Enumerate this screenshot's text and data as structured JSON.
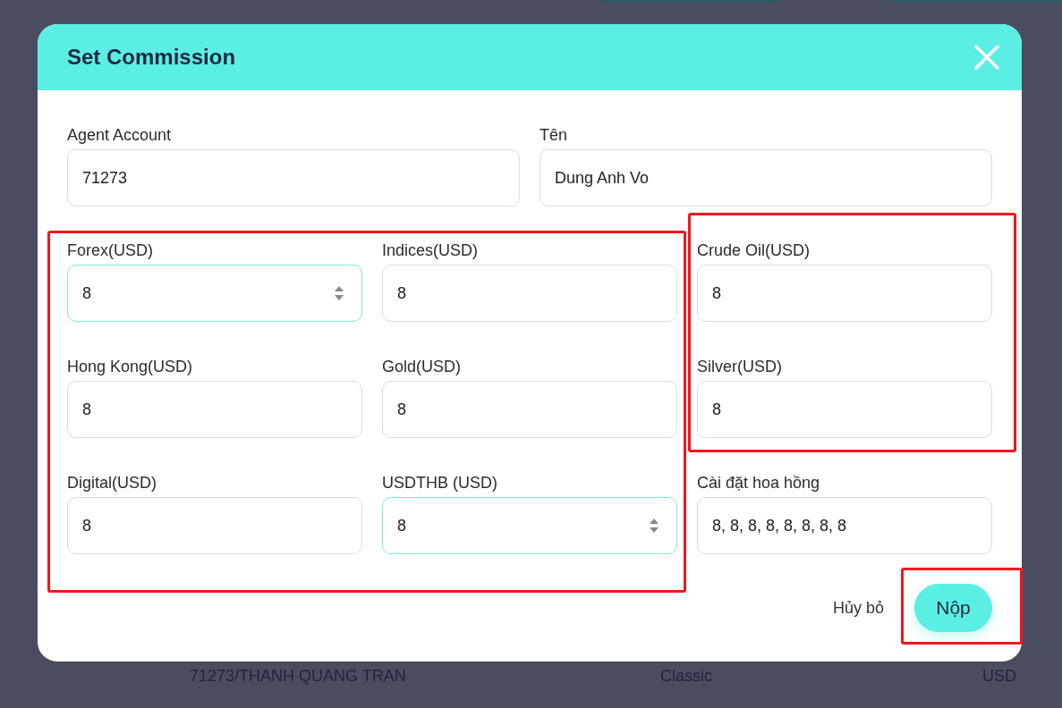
{
  "background_row": {
    "cells": [
      "71273/THANH QUANG TRAN",
      "Classic",
      "USD"
    ]
  },
  "dialog": {
    "title": "Set Commission",
    "top_fields": [
      {
        "label": "Agent Account",
        "value": "71273",
        "focused": false
      },
      {
        "label": "Tên",
        "value": "Dung Anh Vo",
        "focused": false
      }
    ],
    "left_section": {
      "highlighted": true,
      "fields": [
        {
          "label": "Forex(USD)",
          "value": "8",
          "focused": true
        },
        {
          "label": "Indices(USD)",
          "value": "8",
          "focused": false
        },
        {
          "label": "Hong Kong(USD)",
          "value": "8",
          "focused": false
        },
        {
          "label": "Gold(USD)",
          "value": "8",
          "focused": false
        },
        {
          "label": "Digital(USD)",
          "value": "8",
          "focused": false
        },
        {
          "label": "USDTHB (USD)",
          "value": "8",
          "focused": true
        }
      ]
    },
    "right_sections": [
      {
        "highlighted": true,
        "fields": [
          {
            "label": "Crude Oil(USD)",
            "value": "8",
            "focused": false
          },
          {
            "label": "Silver(USD)",
            "value": "8",
            "focused": false
          }
        ]
      },
      {
        "highlighted": false,
        "fields": [
          {
            "label": "Cài đặt hoa hồng",
            "value": "8, 8, 8, 8, 8, 8, 8, 8",
            "focused": false
          }
        ]
      }
    ],
    "actions": [
      {
        "label": "Hủy bỏ",
        "kind": "text",
        "highlighted": false
      },
      {
        "label": "Nộp",
        "kind": "primary",
        "highlighted": true
      }
    ]
  }
}
